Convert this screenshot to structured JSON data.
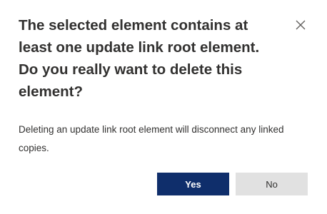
{
  "dialog": {
    "title": "The selected element contains at least one update link root element. Do you really want to delete this element?",
    "message": "Deleting an update link root element will disconnect any linked copies.",
    "close_icon": "close-icon",
    "yes_label": "Yes",
    "no_label": "No",
    "colors": {
      "primary_button": "#0f2e6b",
      "secondary_button": "#e1e1e1",
      "text": "#323130"
    }
  }
}
